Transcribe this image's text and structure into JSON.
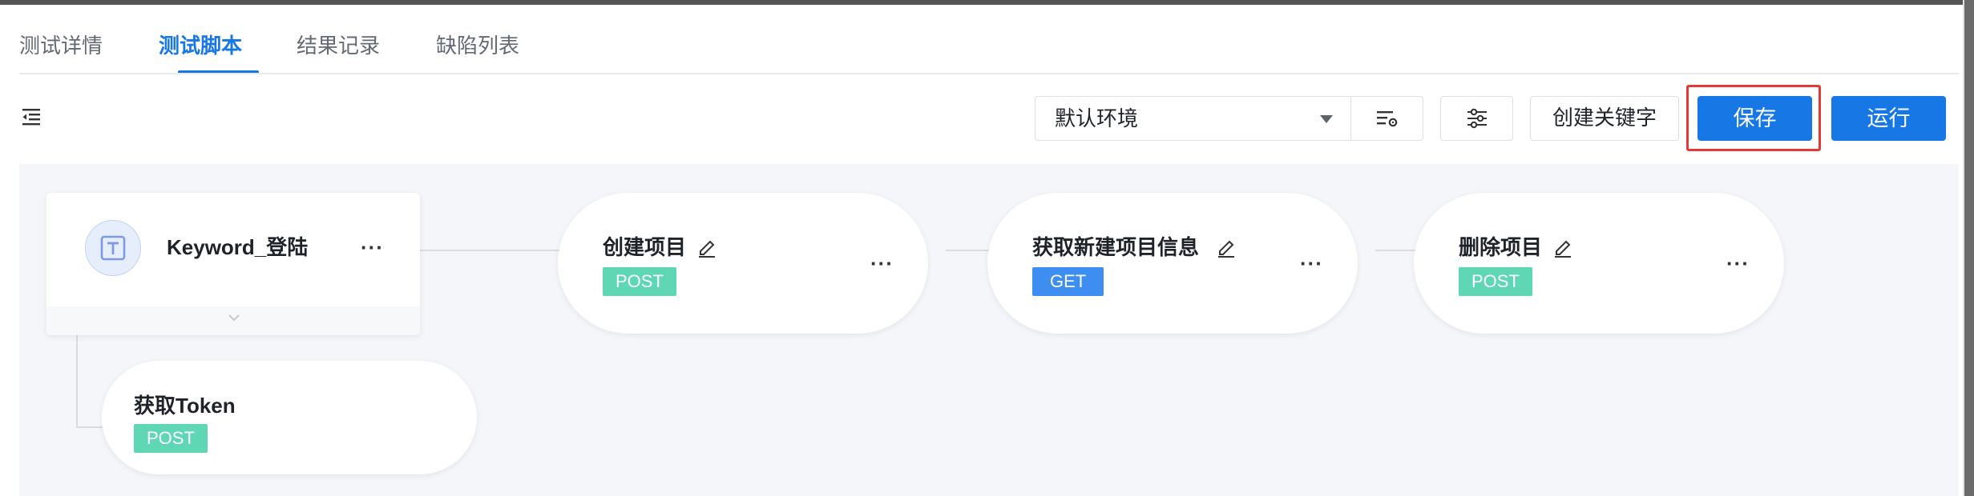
{
  "tabs": [
    {
      "label": "测试详情",
      "active": false
    },
    {
      "label": "测试脚本",
      "active": true
    },
    {
      "label": "结果记录",
      "active": false
    },
    {
      "label": "缺陷列表",
      "active": false
    }
  ],
  "toolbar": {
    "environment": "默认环境",
    "create_keyword_label": "创建关键字",
    "save_label": "保存",
    "run_label": "运行"
  },
  "flow": {
    "keyword": {
      "title": "Keyword_登陆",
      "more": "···"
    },
    "child_step": {
      "name": "获取Token",
      "method": "POST"
    },
    "steps": [
      {
        "name": "创建项目",
        "method": "POST",
        "more": "···"
      },
      {
        "name": "获取新建项目信息",
        "method": "GET",
        "more": "···"
      },
      {
        "name": "删除项目",
        "method": "POST",
        "more": "···"
      }
    ]
  },
  "colors": {
    "primary": "#1677e5",
    "post": "#5fd6b4",
    "get": "#3d8ef0",
    "highlight": "#e53935",
    "canvas": "#f5f6f9"
  }
}
